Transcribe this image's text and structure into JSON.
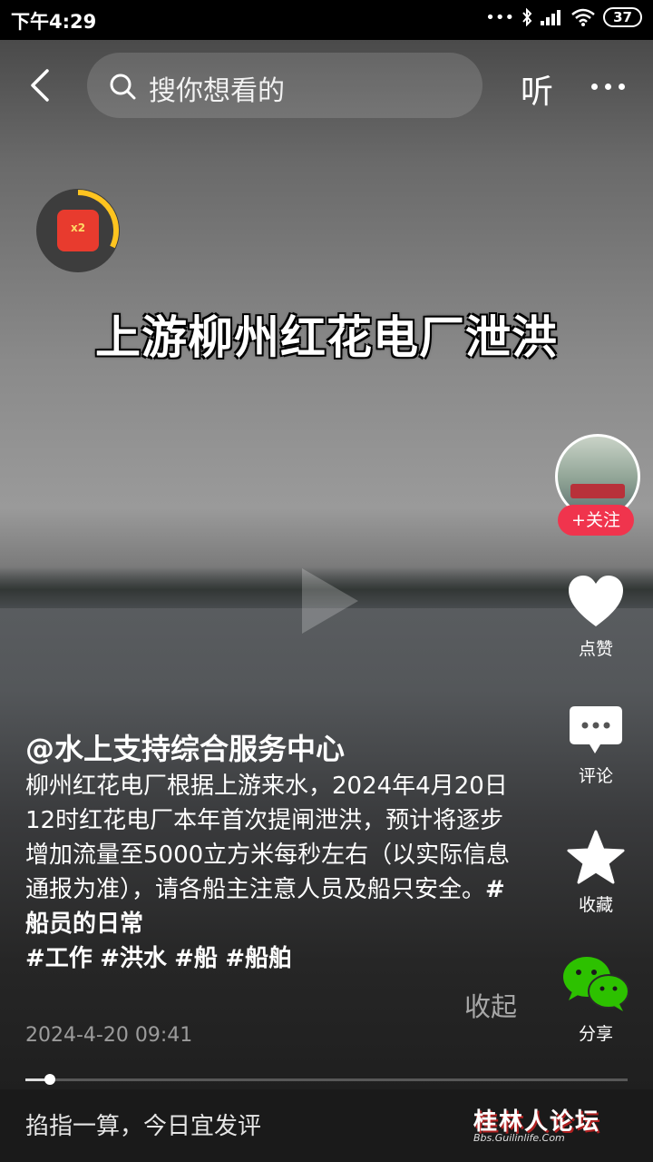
{
  "status_bar": {
    "time": "下午4:29",
    "battery": "37",
    "icons": [
      "dots-icon",
      "bluetooth-icon",
      "signal-icon",
      "wifi-icon",
      "battery-icon"
    ]
  },
  "top_bar": {
    "back_icon": "chevron-left-icon",
    "search_placeholder": "搜你想看的",
    "listen_label": "听",
    "more_icon": "more-dots-icon"
  },
  "red_packet": {
    "badge": "x2"
  },
  "video": {
    "caption": "上游柳州红花电厂泄洪"
  },
  "right_actions": {
    "follow_label": "关注",
    "like_label": "点赞",
    "comment_label": "评论",
    "favorite_label": "收藏",
    "share_label": "分享"
  },
  "post": {
    "username": "@水上支持综合服务中心",
    "description": "柳州红花电厂根据上游来水，2024年4月20日12时红花电厂本年首次提闸泄洪，预计将逐步增加流量至5000立方米每秒左右（以实际信息通报为准），请各船主注意人员及船只安全。",
    "hashtags": [
      "#船员的日常",
      "#工作",
      "#洪水",
      "#船",
      "#船舶"
    ],
    "collapse_label": "收起",
    "date": "2024-4-20 09:41"
  },
  "playback": {
    "progress": 0.04
  },
  "comment_bar": {
    "placeholder": "掐指一算，今日宜发评"
  },
  "watermark": {
    "text": "桂林人论坛",
    "url": "Bbs.Guilinlife.Com"
  },
  "colors": {
    "follow": "#f0344d",
    "wechat": "#2dc100",
    "red_packet": "#e83b2e"
  }
}
